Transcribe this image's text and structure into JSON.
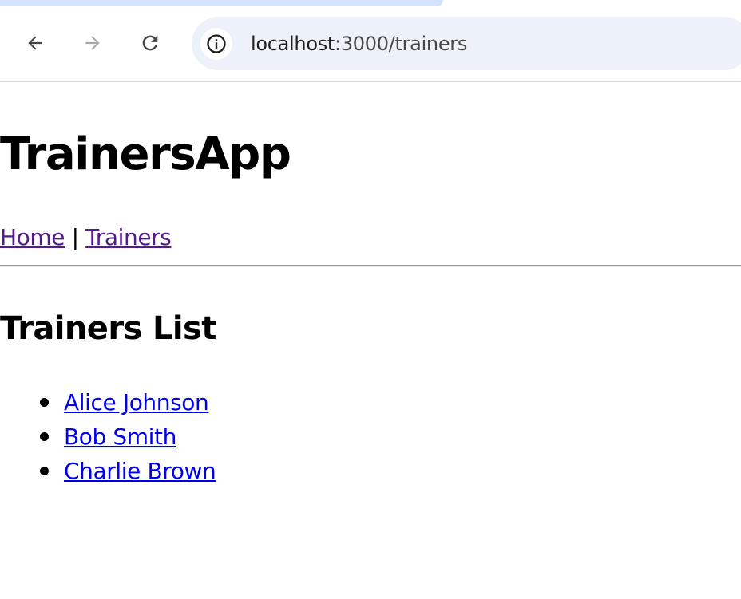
{
  "browser": {
    "url_host": "localhost",
    "url_path": ":3000/trainers",
    "icons": {
      "back": "arrow-left-icon",
      "forward": "arrow-right-icon",
      "reload": "reload-icon",
      "site_info": "info-icon"
    }
  },
  "page": {
    "app_title": "TrainersApp",
    "nav": {
      "home_label": "Home",
      "separator": "|",
      "trainers_label": "Trainers"
    },
    "list_title": "Trainers List",
    "trainers": [
      {
        "name": "Alice Johnson"
      },
      {
        "name": "Bob Smith"
      },
      {
        "name": "Charlie Brown"
      }
    ]
  },
  "colors": {
    "visited_link": "#551a8b",
    "link": "#0000ee",
    "omnibox_bg": "#edf2fa",
    "tab_strip": "#d3e3fd"
  }
}
